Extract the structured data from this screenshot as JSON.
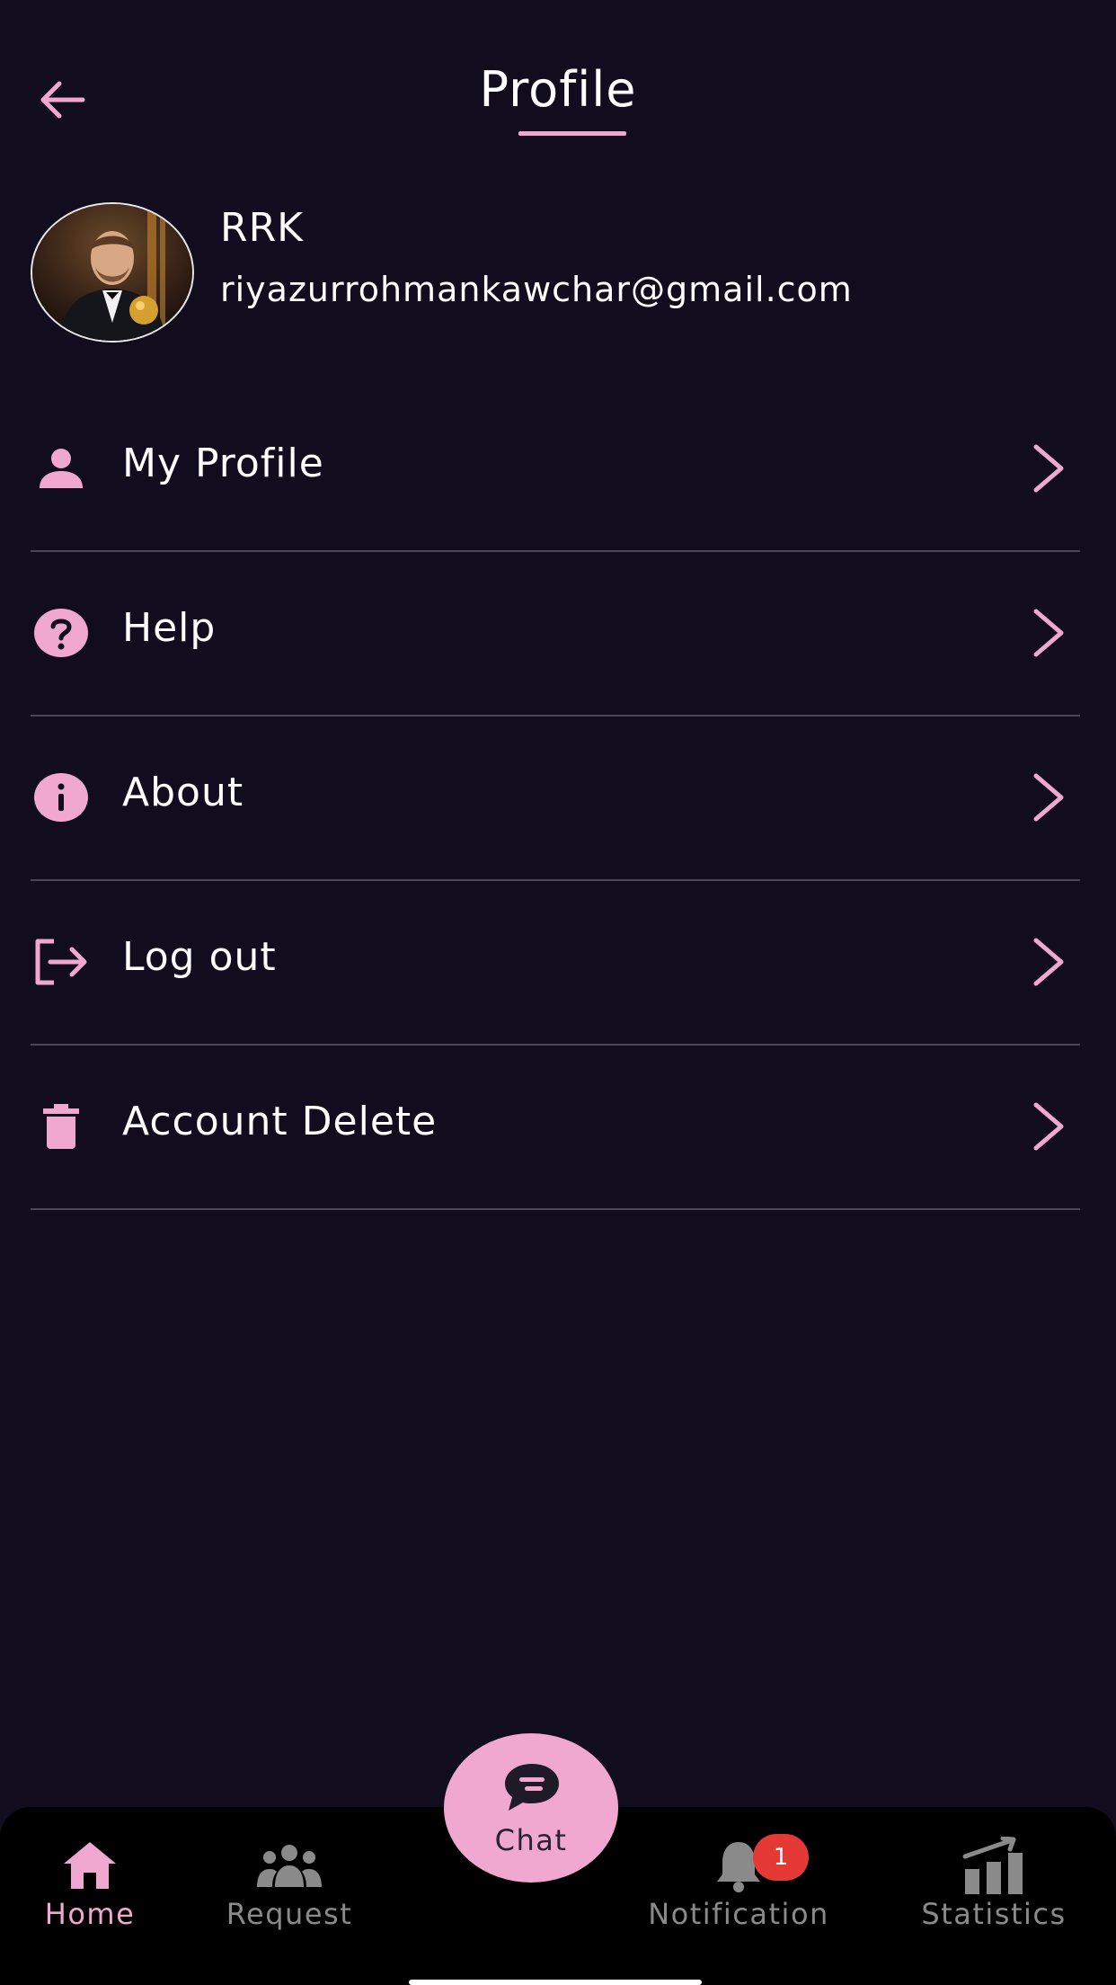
{
  "header": {
    "title": "Profile"
  },
  "user": {
    "name": "RRK",
    "email": "riyazurrohmankawchar@gmail.com"
  },
  "menu": [
    {
      "label": "My Profile",
      "icon": "person-icon"
    },
    {
      "label": "Help",
      "icon": "help-circle-icon"
    },
    {
      "label": "About",
      "icon": "info-icon"
    },
    {
      "label": "Log out",
      "icon": "logout-icon"
    },
    {
      "label": "Account Delete",
      "icon": "trash-icon"
    }
  ],
  "bottom_nav": {
    "items": [
      {
        "label": "Home",
        "icon": "home-icon",
        "active": true
      },
      {
        "label": "Request",
        "icon": "group-icon",
        "active": false
      },
      {
        "label": "Notification",
        "icon": "bell-icon",
        "active": false,
        "badge": "1"
      },
      {
        "label": "Statistics",
        "icon": "bar-chart-icon",
        "active": false
      }
    ],
    "fab": {
      "label": "Chat",
      "icon": "chat-bubble-icon"
    }
  },
  "colors": {
    "background": "#110d1e",
    "accent": "#f0a8d0",
    "divider": "#4a4657",
    "nav_background": "#000000",
    "inactive": "#8a8a8a",
    "badge": "#e53935"
  }
}
